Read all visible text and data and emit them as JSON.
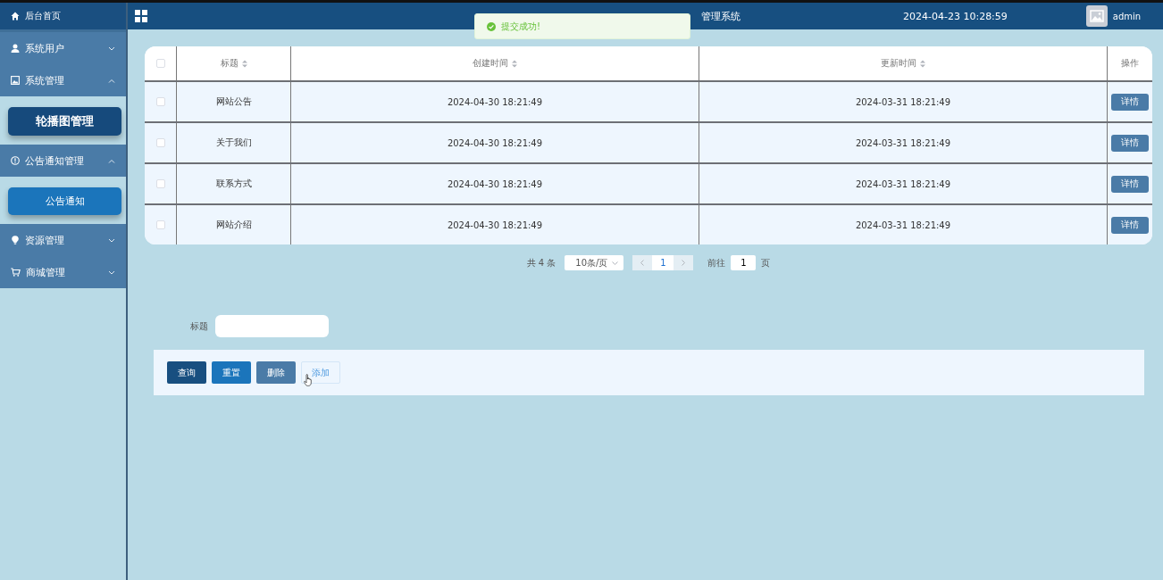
{
  "sidebar": {
    "items": [
      {
        "kind": "link",
        "label": "后台首页"
      },
      {
        "kind": "group",
        "label": "系统用户",
        "expanded": false
      },
      {
        "kind": "group",
        "label": "系统管理",
        "expanded": true,
        "children": [
          {
            "label": "轮播图管理",
            "selected": true
          }
        ]
      },
      {
        "kind": "group",
        "label": "公告通知管理",
        "expanded": true,
        "children": [
          {
            "label": "公告通知",
            "selected": false
          }
        ]
      },
      {
        "kind": "group",
        "label": "资源管理",
        "expanded": false
      },
      {
        "kind": "group",
        "label": "商城管理",
        "expanded": false
      }
    ]
  },
  "header": {
    "title": "管理系统",
    "datetime": "2024-04-23 10:28:59",
    "user": "admin"
  },
  "toast": {
    "message": "提交成功!"
  },
  "table": {
    "columns": [
      {
        "label": "标题",
        "sortable": true
      },
      {
        "label": "创建时间",
        "sortable": true
      },
      {
        "label": "更新时间",
        "sortable": true
      },
      {
        "label": "操作",
        "sortable": false
      }
    ],
    "header_checked": false,
    "rows": [
      {
        "checked": false,
        "title": "网站公告",
        "created": "2024-04-30 18:21:49",
        "updated": "2024-03-31 18:21:49",
        "action": "详情"
      },
      {
        "checked": false,
        "title": "关于我们",
        "created": "2024-04-30 18:21:49",
        "updated": "2024-03-31 18:21:49",
        "action": "详情"
      },
      {
        "checked": false,
        "title": "联系方式",
        "created": "2024-04-30 18:21:49",
        "updated": "2024-03-31 18:21:49",
        "action": "详情"
      },
      {
        "checked": false,
        "title": "网站介绍",
        "created": "2024-04-30 18:21:49",
        "updated": "2024-03-31 18:21:49",
        "action": "详情"
      }
    ]
  },
  "pagination": {
    "total": "共 4 条",
    "page_size": "10条/页",
    "current_page": "1",
    "goto_label": "前往",
    "goto_value": "1",
    "goto_suffix": "页"
  },
  "search": {
    "label": "标题"
  },
  "buttons": [
    {
      "kind": "primary",
      "label": "查询"
    },
    {
      "kind": "secondary",
      "label": "重置"
    },
    {
      "kind": "muted",
      "label": "删除"
    },
    {
      "kind": "outline",
      "label": "添加"
    }
  ]
}
